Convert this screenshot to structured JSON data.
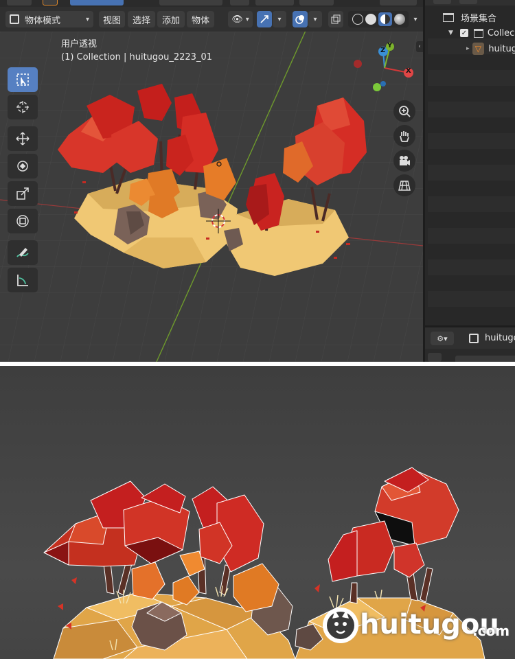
{
  "header": {
    "mode_label": "物体模式",
    "menus": [
      {
        "label": "视图"
      },
      {
        "label": "选择"
      },
      {
        "label": "添加"
      },
      {
        "label": "物体"
      }
    ]
  },
  "viewport": {
    "view_label": "用户透视",
    "collection_label": "(1) Collection | huitugou_2223_01"
  },
  "outliner": {
    "scene_collection_label": "场景集合",
    "collection_label": "Collec",
    "object_label": "huitug"
  },
  "properties": {
    "object_label": "huitugo"
  },
  "gizmo": {
    "x_label": "X",
    "y_label": "Y",
    "z_label": "Z"
  },
  "watermark": {
    "brand": "huitugou",
    "domain": ".com"
  },
  "colors": {
    "accent_blue": "#4772b3",
    "foliage_red": "#c61f1f",
    "foliage_orange": "#e06a1a",
    "ground_sand": "#e8c06a"
  }
}
